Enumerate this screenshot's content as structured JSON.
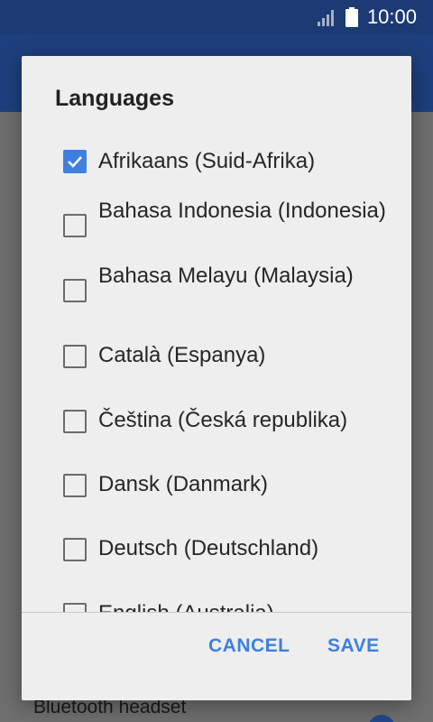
{
  "status_bar": {
    "time": "10:00",
    "icons": [
      "signal-icon",
      "battery-icon"
    ]
  },
  "background": {
    "bottom_label": "Bluetooth headset"
  },
  "dialog": {
    "title": "Languages",
    "items": [
      {
        "label": "Afrikaans (Suid-Afrika)",
        "checked": true
      },
      {
        "label": "Bahasa Indonesia (Indonesia)",
        "checked": false
      },
      {
        "label": "Bahasa Melayu (Malaysia)",
        "checked": false
      },
      {
        "label": "Català (Espanya)",
        "checked": false
      },
      {
        "label": "Čeština (Česká republika)",
        "checked": false
      },
      {
        "label": "Dansk (Danmark)",
        "checked": false
      },
      {
        "label": "Deutsch (Deutschland)",
        "checked": false
      },
      {
        "label": "English (Australia)",
        "checked": false
      }
    ],
    "cancel_label": "CANCEL",
    "save_label": "SAVE"
  },
  "colors": {
    "accent": "#3f7fe0",
    "status_bar": "#1c3a73",
    "dialog_bg": "#eeeeee"
  }
}
